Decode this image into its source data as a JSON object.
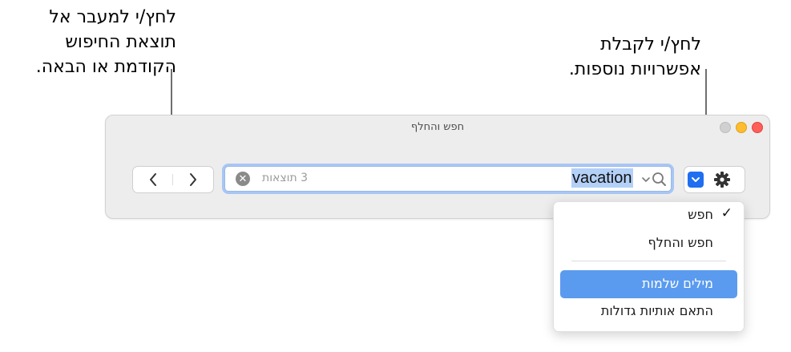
{
  "callouts": {
    "nav": [
      "לחץ/י למעבר אל",
      "תוצאת החיפוש",
      "הקודמת או הבאה."
    ],
    "options": [
      "לחץ/י לקבלת",
      "אפשרויות נוספות."
    ]
  },
  "window": {
    "title": "חפש והחלף"
  },
  "search": {
    "text": "vacation",
    "result_count": "3 תוצאות"
  },
  "menu": {
    "items": [
      "חפש",
      "חפש והחלף",
      "מילים שלמות",
      "התאם אותיות גדולות"
    ],
    "checked": "חפש",
    "highlighted": "מילים שלמות"
  },
  "colors": {
    "accent": "#1f6ff0",
    "highlight": "#5b9bef",
    "close": "#ff5f57",
    "minimize": "#febc2e"
  }
}
